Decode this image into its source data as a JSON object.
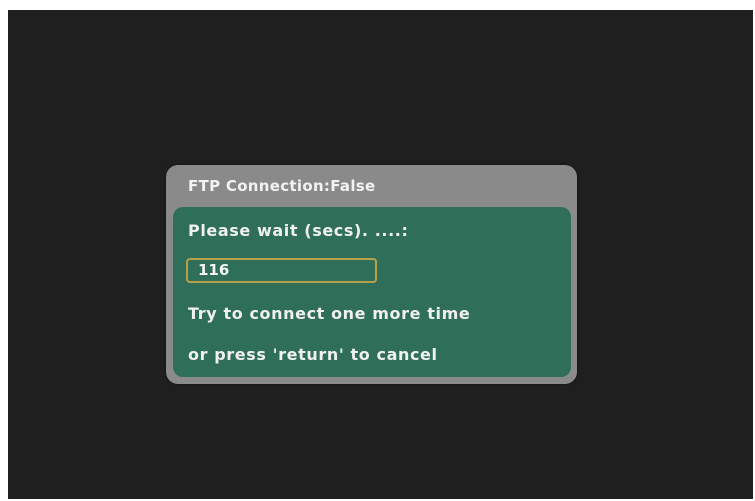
{
  "dialog": {
    "title": "FTP Connection:False",
    "wait_label": "Please wait (secs). ....:",
    "countdown_value": "116",
    "message_line1": "Try to connect one more time",
    "message_line2": "or press 'return' to cancel"
  },
  "colors": {
    "screen_background": "#1f1f1f",
    "dialog_frame": "#8a8a8a",
    "dialog_body": "#2f6f5a",
    "countdown_border": "#b8a04a",
    "text": "#f0f0f0"
  }
}
